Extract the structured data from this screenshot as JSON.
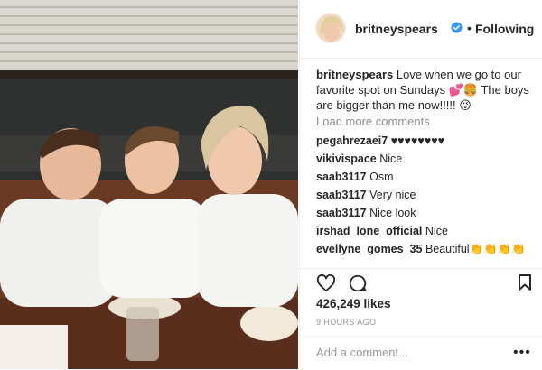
{
  "header": {
    "username": "britneyspears",
    "dot": "•",
    "follow_label": "Following"
  },
  "caption": {
    "username": "britneyspears",
    "text": "Love when we go to our favorite spot on Sundays 💕🍔 The boys are bigger than me now!!!!! 😜"
  },
  "load_more": "Load more comments",
  "comments": [
    {
      "user": "pegahrezaei7",
      "text": "♥♥♥♥♥♥♥♥"
    },
    {
      "user": "vikivispace",
      "text": "Nice"
    },
    {
      "user": "saab3117",
      "text": "Osm"
    },
    {
      "user": "saab3117",
      "text": "Very nice"
    },
    {
      "user": "saab3117",
      "text": "Nice look"
    },
    {
      "user": "irshad_lone_official",
      "text": "Nice"
    },
    {
      "user": "evellyne_gomes_35",
      "text": "Beautiful👏👏👏👏"
    }
  ],
  "likes": "426,249 likes",
  "timestamp": "9 HOURS AGO",
  "add_comment_placeholder": "Add a comment...",
  "more_options": "•••",
  "icons": {
    "like": "heart-icon",
    "comment": "comment-icon",
    "save": "bookmark-icon",
    "verified": "verified-badge-icon"
  },
  "colors": {
    "verified_blue": "#3897f0",
    "text": "#262626",
    "muted": "#8e8e8e"
  }
}
